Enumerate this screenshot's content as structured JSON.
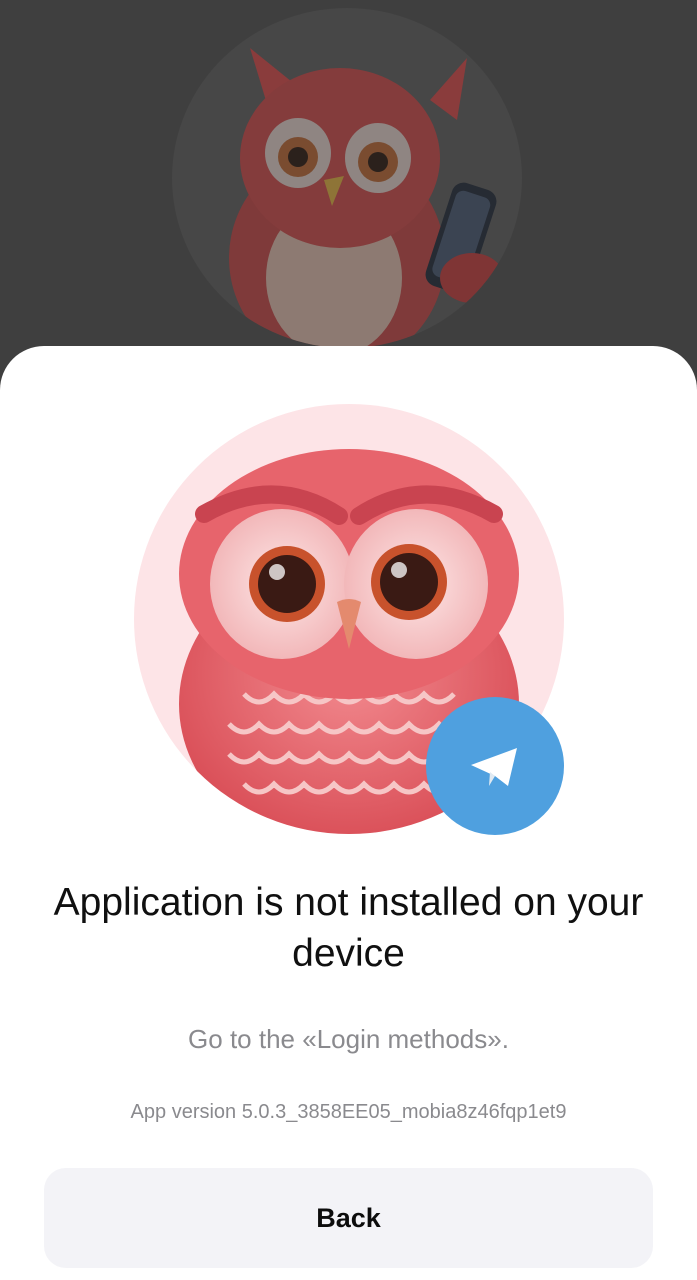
{
  "screen": {
    "title": "Application is not installed on your device",
    "subtitle": "Go to the «Login methods».",
    "app_version": "App version 5.0.3_3858EE05_mobia8z46fqp1et9",
    "back_label": "Back"
  },
  "icons": {
    "background_avatar": "owl-with-phone-icon",
    "main_avatar": "sad-owl-icon",
    "badge": "telegram-icon"
  },
  "colors": {
    "backdrop": "#3f3f3f",
    "sheet": "#ffffff",
    "avatar_background": "#fde4e7",
    "owl": "#e05660",
    "badge": "#4fa0df",
    "button_background": "#f3f3f7",
    "secondary_text": "#8a8a8e"
  }
}
